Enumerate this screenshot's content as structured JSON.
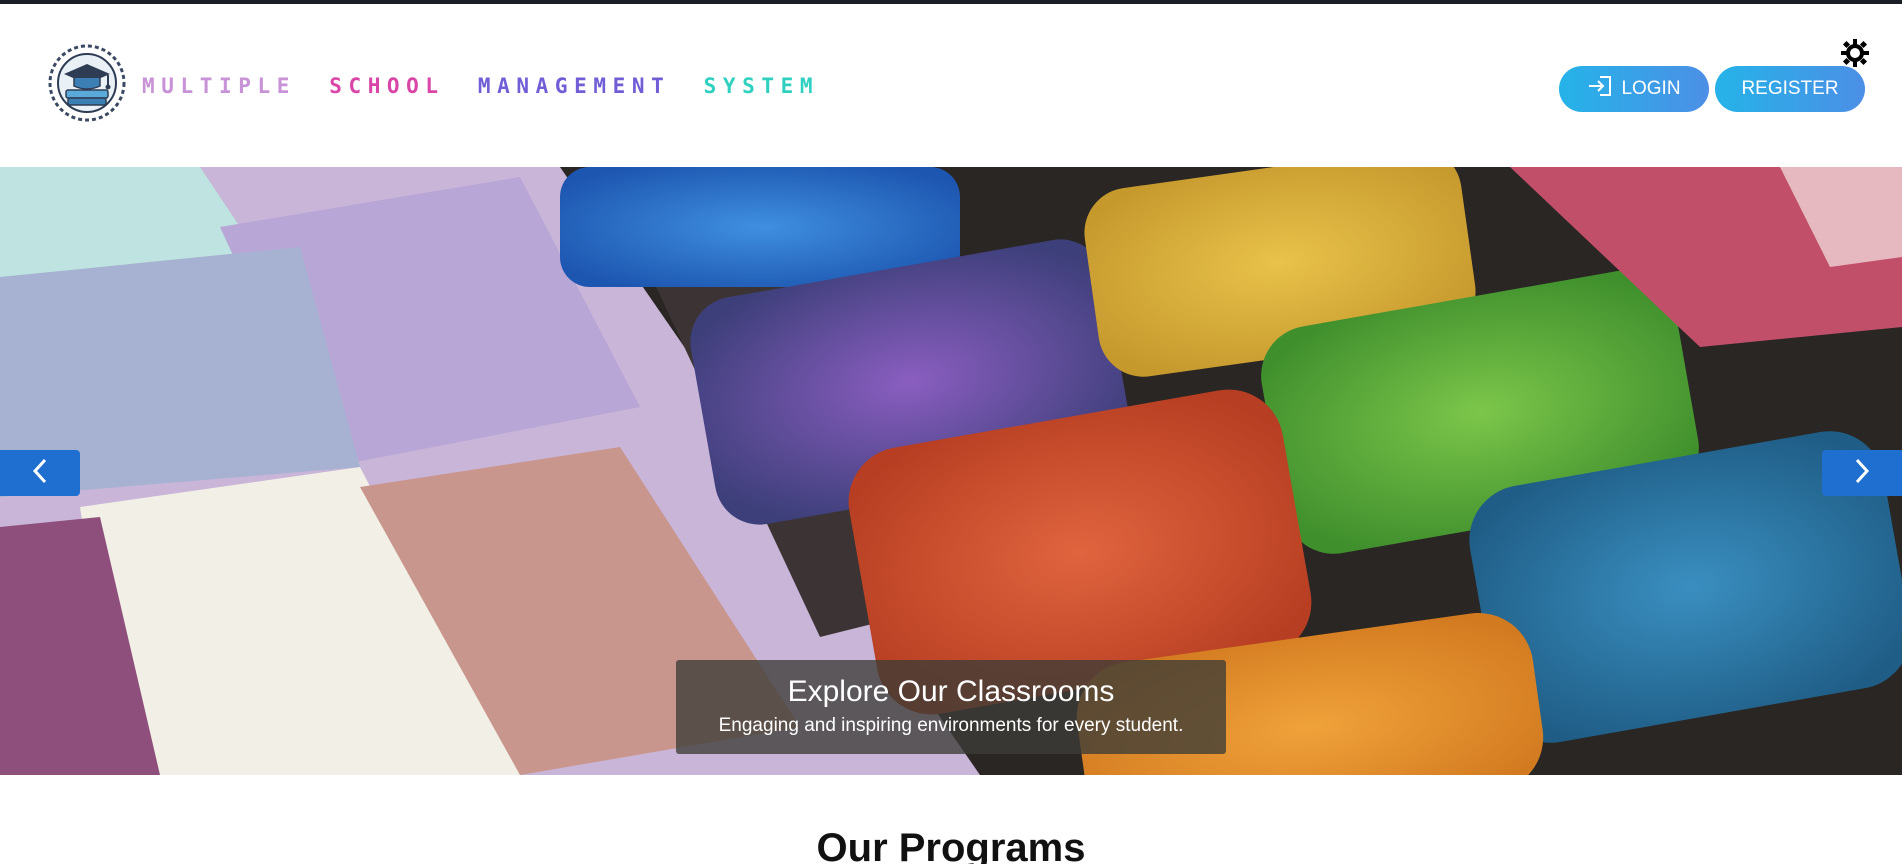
{
  "header": {
    "brand": {
      "words": [
        {
          "text": "MULTIPLE",
          "color": "#c792d6"
        },
        {
          "text": "SCHOOL",
          "color": "#d946a8"
        },
        {
          "text": "MANAGEMENT",
          "color": "#6f5ed6"
        },
        {
          "text": "SYSTEM",
          "color": "#2fd0c0"
        }
      ]
    },
    "login_label": "LOGIN",
    "register_label": "REGISTER",
    "logo_icon": "school-logo-icon",
    "theme_icon": "sun-icon"
  },
  "carousel": {
    "caption_title": "Explore Our Classrooms",
    "caption_text": "Engaging and inspiring environments for every student.",
    "prev_icon": "chevron-left-icon",
    "next_icon": "chevron-right-icon",
    "accent": "#1f6fd1"
  },
  "programs": {
    "title": "Our Programs"
  }
}
